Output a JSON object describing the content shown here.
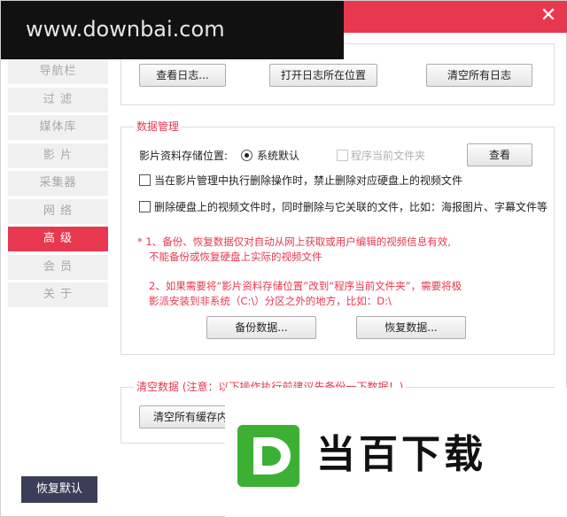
{
  "watermark": {
    "text": "www.downbai.com"
  },
  "window": {
    "close_glyph": "✕"
  },
  "sidebar": {
    "items": [
      {
        "label": "导航栏",
        "active": false
      },
      {
        "label": "过 滤",
        "active": false
      },
      {
        "label": "媒体库",
        "active": false
      },
      {
        "label": "影 片",
        "active": false
      },
      {
        "label": "采集器",
        "active": false
      },
      {
        "label": "网 络",
        "active": false
      },
      {
        "label": "高 级",
        "active": true
      },
      {
        "label": "会 员",
        "active": false
      },
      {
        "label": "关 于",
        "active": false
      }
    ],
    "restore_default": "恢复默认"
  },
  "log_panel": {
    "view_logs": "查看日志...",
    "open_log_location": "打开日志所在位置",
    "clear_all_logs": "清空所有日志"
  },
  "data_management": {
    "title": "数据管理",
    "storage_label": "影片资料存储位置:",
    "option_system_default": "系统默认",
    "option_program_folder": "程序当前文件夹",
    "view_button": "查看",
    "checkbox_prevent_delete": "当在影片管理中执行删除操作时，禁止删除对应硬盘上的视频文件",
    "checkbox_delete_related": "删除硬盘上的视频文件时，同时删除与它关联的文件，比如：海报图片、字幕文件等",
    "notes": [
      "* 1、备份、恢复数据仅对自动从网上获取或用户编辑的视频信息有效,",
      "不能备份或恢复硬盘上实际的视频文件",
      "2、如果需要将“影片资料存储位置”改到“程序当前文件夹”，需要将极",
      "影派安装到非系统（C:\\）分区之外的地方，比如：D:\\"
    ],
    "backup_button": "备份数据...",
    "restore_button": "恢复数据..."
  },
  "clear_data": {
    "title": "清空数据 (注意：以下操作执行前建议先备份一下数据！)",
    "clear_cache_button": "清空所有缓存内容"
  },
  "logo": {
    "text": "当百下载",
    "mark_letter": "D",
    "colors": {
      "green": "#3cb034",
      "dark": "#111111"
    }
  },
  "colors": {
    "accent": "#e8384f",
    "sidebar_bg": "#f0f0f0",
    "restore_bg": "#3b3e58"
  }
}
